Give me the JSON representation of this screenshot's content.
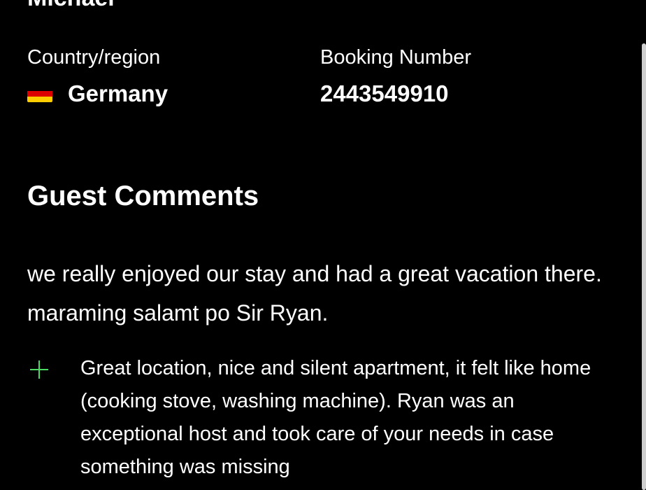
{
  "guest": {
    "name": "Michael"
  },
  "details": {
    "country_label": "Country/region",
    "country_value": "Germany",
    "flag_icon": "germany-flag-icon",
    "flag_colors": [
      "#000000",
      "#dd0000",
      "#ffce00"
    ],
    "booking_label": "Booking Number",
    "booking_value": "2443549910"
  },
  "comments": {
    "title": "Guest Comments",
    "text": "we really enjoyed our stay and had a great vacation there. maraming salamt po Sir Ryan.",
    "positive_icon": "plus-icon",
    "positive_color": "#4cd964",
    "positive_text": "Great location, nice and silent apartment,  it felt like home (cooking stove, washing machine). Ryan was an exceptional host and took care of your needs in case something was missing"
  }
}
